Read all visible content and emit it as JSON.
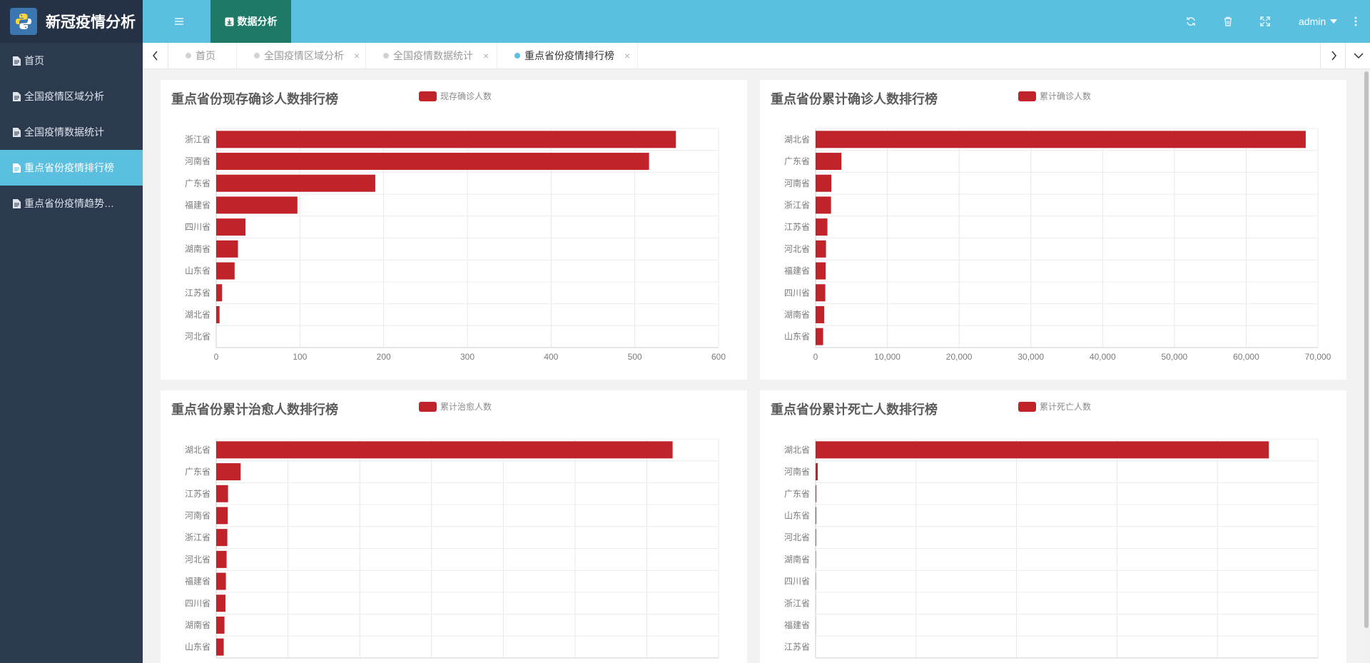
{
  "app": {
    "title": "新冠疫情分析",
    "logo_icon": "python-logo-icon",
    "logo_caption": "python"
  },
  "sidebar": {
    "items": [
      {
        "label": "首页",
        "icon": "document-icon",
        "active": false
      },
      {
        "label": "全国疫情区域分析",
        "icon": "document-icon",
        "active": false
      },
      {
        "label": "全国疫情数据统计",
        "icon": "document-icon",
        "active": false
      },
      {
        "label": "重点省份疫情排行榜",
        "icon": "document-icon",
        "active": true
      },
      {
        "label": "重点省份疫情趋势…",
        "icon": "document-icon",
        "active": false
      }
    ]
  },
  "header": {
    "module_tab": "数据分析",
    "user": "admin",
    "icons": [
      "menu-icon",
      "refresh-icon",
      "trash-icon",
      "fullscreen-icon",
      "more-vertical-icon"
    ]
  },
  "tabs": [
    {
      "label": "首页",
      "closable": false,
      "active": false
    },
    {
      "label": "全国疫情区域分析",
      "closable": true,
      "active": false
    },
    {
      "label": "全国疫情数据统计",
      "closable": true,
      "active": false
    },
    {
      "label": "重点省份疫情排行榜",
      "closable": true,
      "active": true
    }
  ],
  "tab_close_symbol": "×",
  "colors": {
    "accent": "#5bbfe0",
    "sidebar": "#2c3a4f",
    "module_tab": "#1e7a67",
    "bar": "#c1232b"
  },
  "chart_data": [
    {
      "type": "bar",
      "orientation": "horizontal",
      "title": "重点省份现存确诊人数排行榜",
      "legend": "现存确诊人数",
      "categories": [
        "浙江省",
        "河南省",
        "广东省",
        "福建省",
        "四川省",
        "湖南省",
        "山东省",
        "江苏省",
        "湖北省",
        "河北省"
      ],
      "series": [
        {
          "name": "现存确诊人数",
          "values": [
            549,
            517,
            190,
            97,
            35,
            26,
            22,
            7,
            4,
            0
          ]
        }
      ],
      "xlim": [
        0,
        600
      ],
      "ticks": [
        0,
        100,
        200,
        300,
        400,
        500,
        600
      ],
      "tick_labels": [
        "0",
        "100",
        "200",
        "300",
        "400",
        "500",
        "600"
      ],
      "grid": true
    },
    {
      "type": "bar",
      "orientation": "horizontal",
      "title": "重点省份累计确诊人数排行榜",
      "legend": "累计确诊人数",
      "categories": [
        "湖北省",
        "广东省",
        "河南省",
        "浙江省",
        "江苏省",
        "河北省",
        "福建省",
        "四川省",
        "湖南省",
        "山东省"
      ],
      "series": [
        {
          "name": "累计确诊人数",
          "values": [
            68300,
            3600,
            2200,
            2150,
            1650,
            1450,
            1400,
            1350,
            1200,
            1050
          ]
        }
      ],
      "xlim": [
        0,
        70000
      ],
      "ticks": [
        0,
        10000,
        20000,
        30000,
        40000,
        50000,
        60000,
        70000
      ],
      "tick_labels": [
        "0",
        "10,000",
        "20,000",
        "30,000",
        "40,000",
        "50,000",
        "60,000",
        "70,000"
      ],
      "grid": true
    },
    {
      "type": "bar",
      "orientation": "horizontal",
      "title": "重点省份累计治愈人数排行榜",
      "legend": "累计治愈人数",
      "categories": [
        "湖北省",
        "广东省",
        "江苏省",
        "河南省",
        "浙江省",
        "河北省",
        "福建省",
        "四川省",
        "湖南省",
        "山东省"
      ],
      "series": [
        {
          "name": "累计治愈人数",
          "values": [
            63600,
            3400,
            1650,
            1600,
            1550,
            1450,
            1350,
            1300,
            1150,
            1050
          ]
        }
      ],
      "xlim": [
        0,
        70000
      ],
      "ticks": [
        0,
        10000,
        20000,
        30000,
        40000,
        50000,
        60000,
        70000
      ],
      "tick_labels": [],
      "grid": true
    },
    {
      "type": "bar",
      "orientation": "horizontal",
      "title": "重点省份累计死亡人数排行榜",
      "legend": "累计死亡人数",
      "categories": [
        "湖北省",
        "河南省",
        "广东省",
        "山东省",
        "河北省",
        "湖南省",
        "四川省",
        "浙江省",
        "福建省",
        "江苏省"
      ],
      "series": [
        {
          "name": "累计死亡人数",
          "values": [
            4512,
            22,
            8,
            7,
            6,
            4,
            3,
            1,
            1,
            0
          ]
        }
      ],
      "xlim": [
        0,
        5000
      ],
      "ticks": [
        0,
        1000,
        2000,
        3000,
        4000,
        5000
      ],
      "tick_labels": [],
      "grid": true
    }
  ]
}
